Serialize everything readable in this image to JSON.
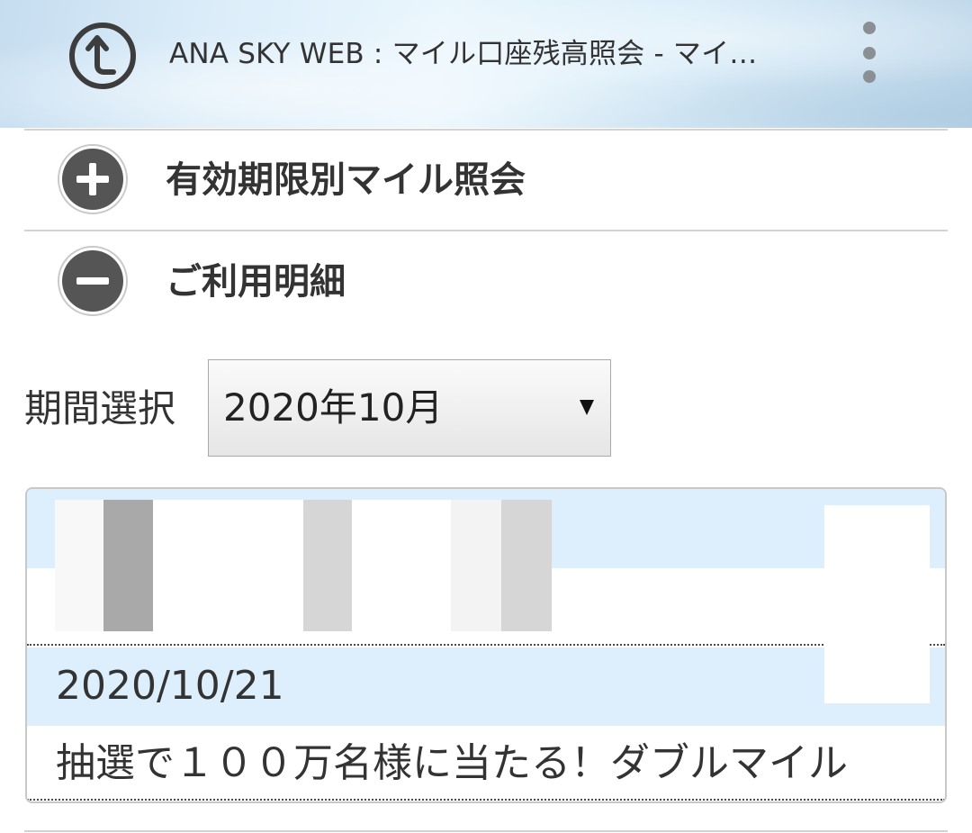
{
  "header": {
    "title": "ANA SKY WEB : マイル口座残高照会 - マイ…",
    "app_icon": "circular-back-arrow-icon",
    "menu_icon": "kebab-menu-icon"
  },
  "accordion": {
    "items": [
      {
        "label": "有効期限別マイル照会",
        "icon": "plus-circle-icon",
        "expanded": false
      },
      {
        "label": "ご利用明細",
        "icon": "minus-circle-icon",
        "expanded": true
      }
    ]
  },
  "period": {
    "label": "期間選択",
    "selected": "2020年10月"
  },
  "history": {
    "entries": [
      {
        "date": "2020/10/21",
        "description": "抽選で１００万名様に当たる！ダブルマイル"
      }
    ]
  },
  "colors": {
    "header_gradient": "#dcedf9",
    "row_highlight": "#ddeffc",
    "icon_dark": "#555555",
    "divider": "#d2d2d2"
  }
}
